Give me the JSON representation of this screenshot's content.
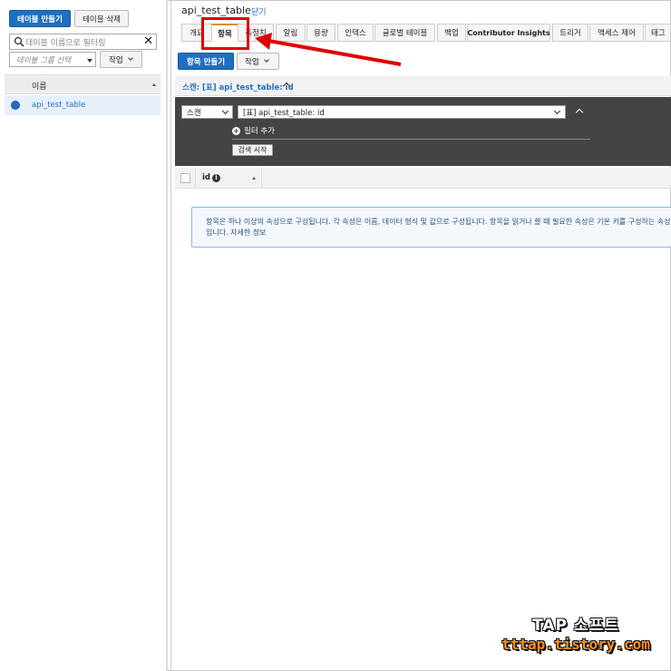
{
  "left_panel": {
    "create_table_label": "테이블 만들기",
    "delete_table_label": "테이블 삭제",
    "search_placeholder": "테이블 이름으로 필터링",
    "group_select_placeholder": "테이블 그룹 선택",
    "action_label": "작업",
    "list_header": "이름",
    "tables": [
      "api_test_table"
    ]
  },
  "header": {
    "title": "api_test_table",
    "close_label": "닫기"
  },
  "tabs": [
    "개요",
    "항목",
    "측정치",
    "알림",
    "용량",
    "인덱스",
    "글로벌 테이블",
    "백업",
    "Contributor Insights",
    "트리거",
    "액세스 제어",
    "태그"
  ],
  "active_tab": "항목",
  "toolbar": {
    "create_item_label": "항목 만들기",
    "action_label": "작업"
  },
  "scan": {
    "header": "스캔: [표] api_test_table: id",
    "mode_value": "스캔",
    "target_value": "[표] api_test_table: id",
    "add_filter_label": "필터 추가",
    "start_search_label": "검색 시작"
  },
  "table": {
    "columns": [
      "id"
    ]
  },
  "info_message": "항목은 하나 이상의 속성으로 구성됩니다. 각 속성은 이름, 데이터 형식 및 값으로 구성됩니다. 항목을 읽거나 쓸 때 필요한 속성은 기본 키를 구성하는 속성뿐입니다. 자세한 정보",
  "watermark": {
    "line1": "TAP 소프트",
    "line2": "tttap.tistory.com"
  },
  "colors": {
    "primary": "#1f6fc1",
    "annotation": "#e00000",
    "active_tab_accent": "#e58c00",
    "filter_panel": "#444444"
  }
}
